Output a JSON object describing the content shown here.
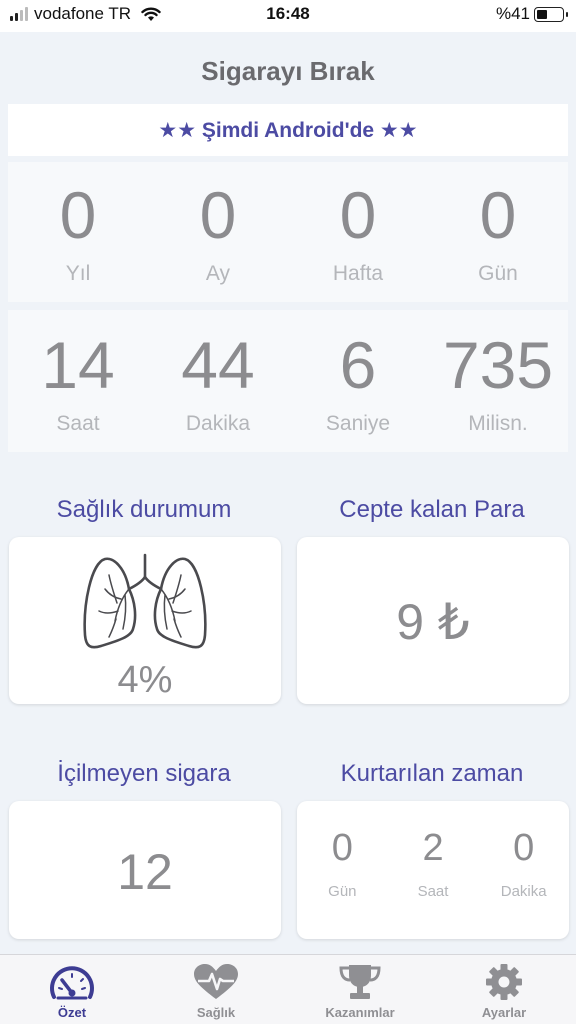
{
  "status_bar": {
    "carrier": "vodafone TR",
    "time": "16:48",
    "battery": "%41",
    "battery_level": 0.41
  },
  "header": {
    "title": "Sigarayı Bırak"
  },
  "promo": {
    "text": "★★ Şimdi Android'de ★★"
  },
  "counters_top": [
    {
      "value": "0",
      "label": "Yıl"
    },
    {
      "value": "0",
      "label": "Ay"
    },
    {
      "value": "0",
      "label": "Hafta"
    },
    {
      "value": "0",
      "label": "Gün"
    }
  ],
  "counters_bottom": [
    {
      "value": "14",
      "label": "Saat"
    },
    {
      "value": "44",
      "label": "Dakika"
    },
    {
      "value": "6",
      "label": "Saniye"
    },
    {
      "value": "735",
      "label": "Milisn."
    }
  ],
  "health": {
    "title": "Sağlık durumum",
    "percent": "4%",
    "icon": "lungs-icon"
  },
  "money": {
    "title": "Cepte kalan Para",
    "value": "9 ₺"
  },
  "cigarettes": {
    "title": "İçilmeyen sigara",
    "value": "12"
  },
  "saved_time": {
    "title": "Kurtarılan zaman",
    "items": [
      {
        "value": "0",
        "label": "Gün"
      },
      {
        "value": "2",
        "label": "Saat"
      },
      {
        "value": "0",
        "label": "Dakika"
      }
    ]
  },
  "tabs": [
    {
      "label": "Özet",
      "icon": "speedometer-icon",
      "active": true
    },
    {
      "label": "Sağlık",
      "icon": "heart-pulse-icon",
      "active": false
    },
    {
      "label": "Kazanımlar",
      "icon": "trophy-icon",
      "active": false
    },
    {
      "label": "Ayarlar",
      "icon": "gear-icon",
      "active": false
    }
  ],
  "colors": {
    "accent": "#4c4ba3",
    "background": "#eff3f8",
    "card": "#ffffff",
    "number": "#8c8c8f",
    "label": "#b4b6ba"
  }
}
